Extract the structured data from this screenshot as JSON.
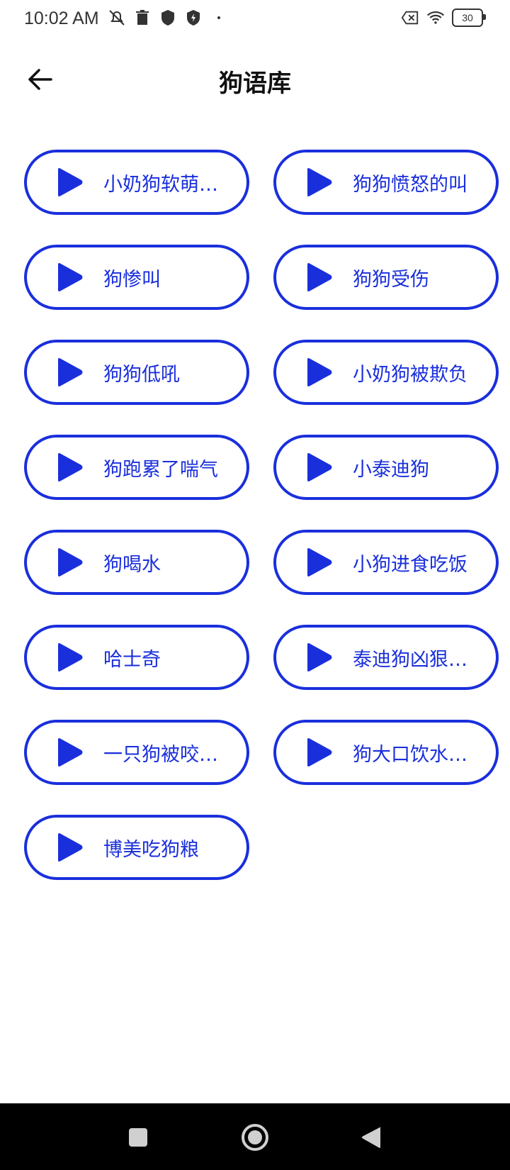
{
  "status_bar": {
    "time": "10:02 AM",
    "left_icons": [
      "mute-icon",
      "trash-icon",
      "shield-icon",
      "shield-bolt-icon",
      "dot-icon"
    ],
    "right_icons": [
      "sim-x-icon",
      "wifi-icon"
    ],
    "battery": "30"
  },
  "header": {
    "title": "狗语库",
    "back_icon": "back-arrow-icon"
  },
  "items": [
    {
      "label": "小奶狗软萌叫..."
    },
    {
      "label": "狗狗愤怒的叫"
    },
    {
      "label": "狗惨叫"
    },
    {
      "label": "狗狗受伤"
    },
    {
      "label": "狗狗低吼"
    },
    {
      "label": "小奶狗被欺负"
    },
    {
      "label": "狗跑累了喘气"
    },
    {
      "label": "小泰迪狗"
    },
    {
      "label": "狗喝水"
    },
    {
      "label": "小狗进食吃饭"
    },
    {
      "label": "哈士奇"
    },
    {
      "label": "泰迪狗凶狠的..."
    },
    {
      "label": "一只狗被咬伤..."
    },
    {
      "label": "狗大口饮水的..."
    },
    {
      "label": "博美吃狗粮"
    }
  ],
  "colors": {
    "accent": "#1a2fdc",
    "nav_bg": "#000000"
  },
  "nav": {
    "icons": [
      "recent-apps-icon",
      "home-icon",
      "back-icon"
    ]
  }
}
